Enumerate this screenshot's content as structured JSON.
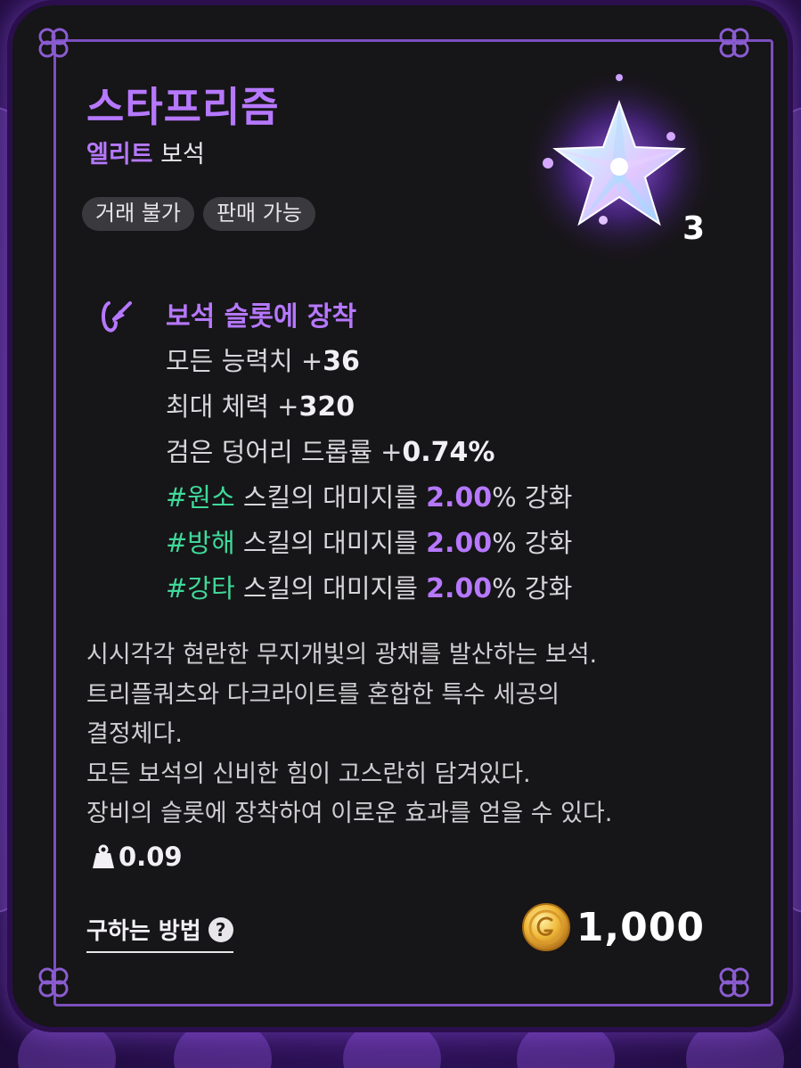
{
  "item": {
    "name": "스타프리즘",
    "grade": "엘리트",
    "category": "보석",
    "quantity": "3",
    "tags": [
      "거래 불가",
      "판매 가능"
    ]
  },
  "equip": {
    "title": "보석 슬롯에 장착",
    "stats": [
      {
        "label": "모든 능력치 +",
        "value": "36"
      },
      {
        "label": "최대 체력 +",
        "value": "320"
      },
      {
        "label": "검은 덩어리 드롭률 +",
        "value": "0.74%"
      }
    ],
    "skills": [
      {
        "tag": "#원소",
        "text": " 스킬의 대미지를 ",
        "value": "2.00",
        "suffix": "% 강화"
      },
      {
        "tag": "#방해",
        "text": " 스킬의 대미지를 ",
        "value": "2.00",
        "suffix": "% 강화"
      },
      {
        "tag": "#강타",
        "text": " 스킬의 대미지를 ",
        "value": "2.00",
        "suffix": "% 강화"
      }
    ]
  },
  "description": [
    "시시각각 현란한 무지개빛의 광채를 발산하는 보석.",
    "트리플쿼츠와 다크라이트를 혼합한 특수 세공의",
    "결정체다.",
    "모든 보석의 신비한 힘이 고스란히 담겨있다.",
    "장비의 슬롯에 장착하여 이로운 효과를 얻을 수 있다."
  ],
  "weight": "0.09",
  "how_to_obtain": "구하는 방법",
  "help_icon": "?",
  "price": "1,000",
  "icons": {
    "item": "star-prism-gem-icon",
    "equip": "equip-slot-icon",
    "weight": "weight-icon",
    "help": "question-circle-icon",
    "currency": "gold-coin-icon"
  },
  "colors": {
    "accent": "#b678ff",
    "skill_tag": "#3fd99a",
    "card_bg": "#161517",
    "frame": "#7b4fbf"
  }
}
